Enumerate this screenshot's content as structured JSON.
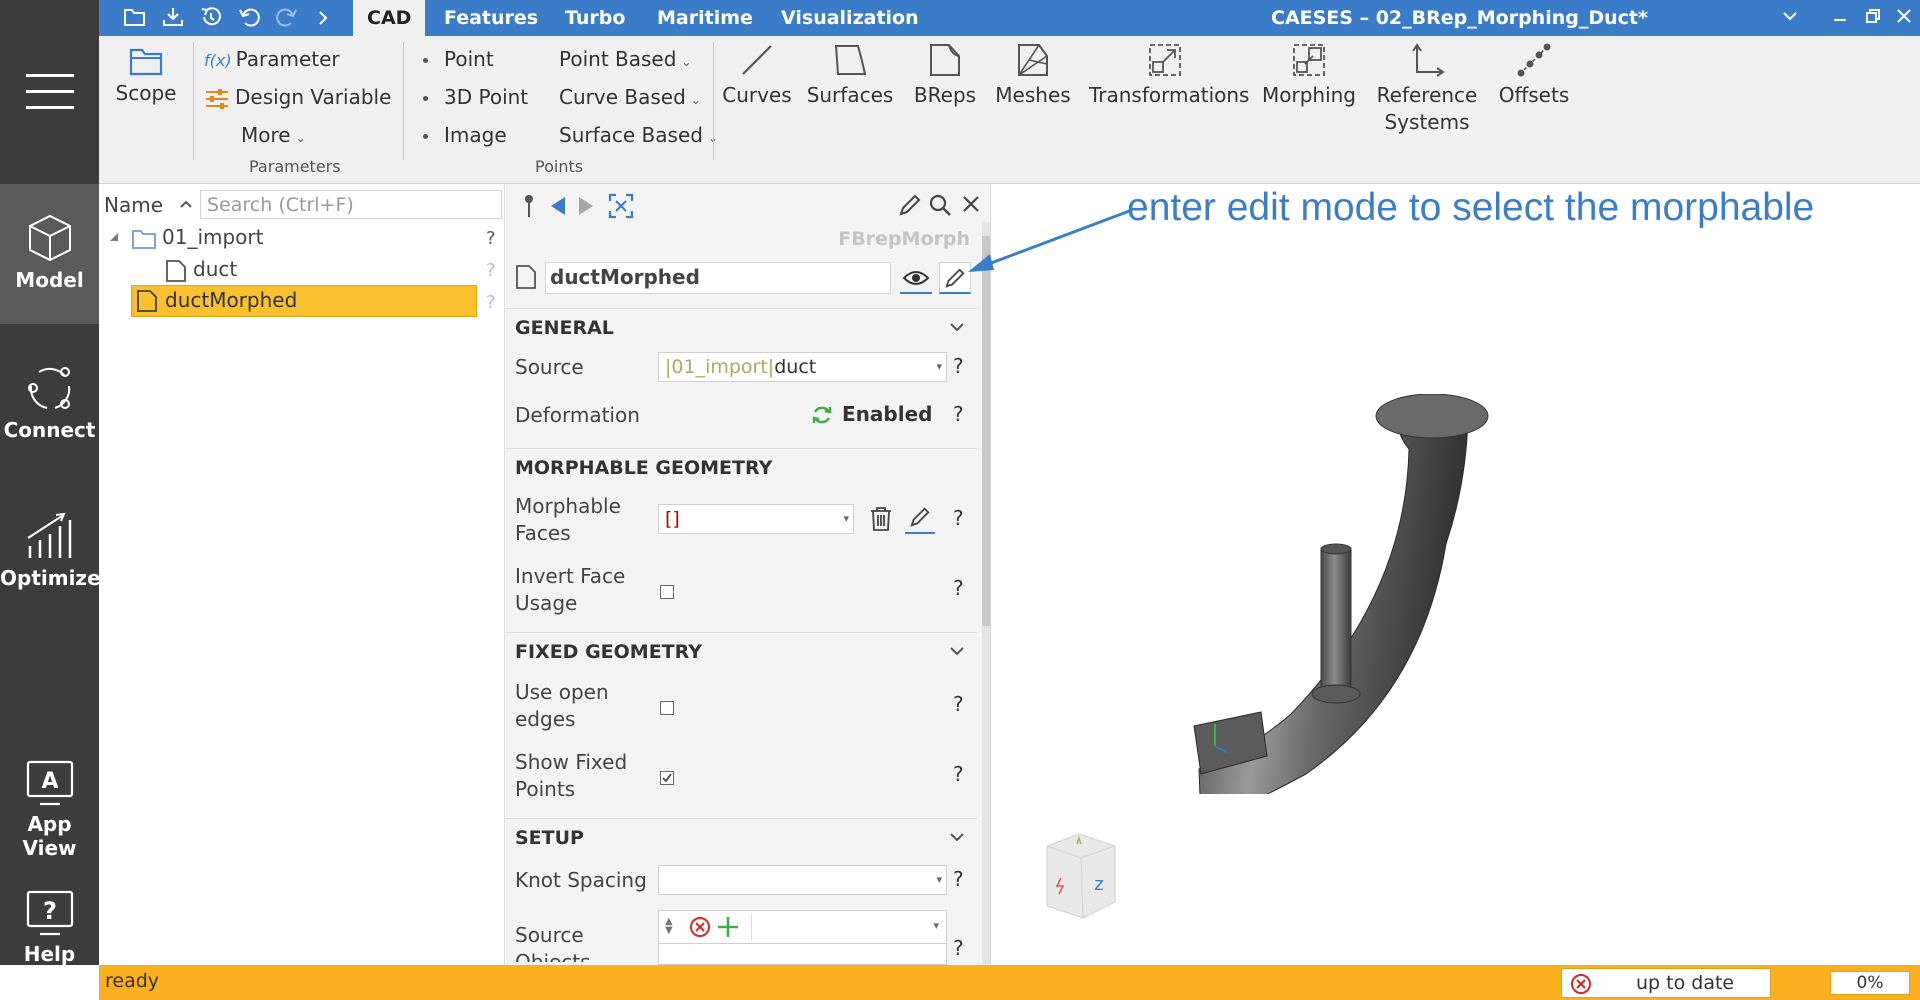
{
  "window": {
    "title": "CAESES – 02_BRep_Morphing_Duct*",
    "menu_tabs": [
      "CAD",
      "Features",
      "Turbo",
      "Maritime",
      "Visualization"
    ],
    "active_tab": "CAD"
  },
  "leftnav": {
    "items": [
      {
        "label": "Model",
        "icon": "cube-icon",
        "active": true
      },
      {
        "label": "Connect",
        "icon": "connect-icon",
        "active": false
      },
      {
        "label": "Optimize",
        "icon": "chart-icon",
        "active": false
      },
      {
        "label": "App View",
        "icon": "app-view-icon",
        "active": false
      },
      {
        "label": "Help",
        "icon": "help-icon",
        "active": false
      }
    ]
  },
  "ribbon": {
    "scope_label": "Scope",
    "parameter_label": "Parameter",
    "parameter_prefix": "f(x)",
    "design_variable_label": "Design Variable",
    "more_label": "More",
    "parameters_group": "Parameters",
    "point_label": "Point",
    "point3d_label": "3D Point",
    "image_label": "Image",
    "point_based_label": "Point Based",
    "curve_based_label": "Curve Based",
    "surface_based_label": "Surface Based",
    "points_group": "Points",
    "curves_label": "Curves",
    "surfaces_label": "Surfaces",
    "breps_label": "BReps",
    "meshes_label": "Meshes",
    "transformations_label": "Transformations",
    "morphing_label": "Morphing",
    "reference_label_1": "Reference",
    "reference_label_2": "Systems",
    "offsets_label": "Offsets"
  },
  "tree": {
    "name_header": "Name",
    "search_placeholder": "Search (Ctrl+F)",
    "items": [
      {
        "label": "01_import",
        "type": "folder"
      },
      {
        "label": "duct",
        "type": "object"
      },
      {
        "label": "ductMorphed",
        "type": "object",
        "selected": true
      }
    ],
    "help_mark": "?"
  },
  "properties": {
    "type_label": "FBrepMorph",
    "object_name": "ductMorphed",
    "help_mark": "?",
    "sections": {
      "general": "GENERAL",
      "morphable": "MORPHABLE GEOMETRY",
      "fixed": "FIXED GEOMETRY",
      "setup": "SETUP"
    },
    "source_label": "Source",
    "source_prefix": "|01_import|",
    "source_value": "duct",
    "deformation_label": "Deformation",
    "deformation_value": "Enabled",
    "morphable_faces_label_1": "Morphable",
    "morphable_faces_label_2": "Faces",
    "morphable_faces_value": "[]",
    "invert_label_1": "Invert Face",
    "invert_label_2": "Usage",
    "invert_checked": false,
    "open_edges_label_1": "Use open",
    "open_edges_label_2": "edges",
    "open_edges_checked": false,
    "show_fixed_label_1": "Show Fixed",
    "show_fixed_label_2": "Points",
    "show_fixed_checked": true,
    "knot_spacing_label": "Knot Spacing",
    "knot_spacing_value": "",
    "source_objects_label_1": "Source",
    "source_objects_label_2": "Objects"
  },
  "viewport": {
    "annotation": "enter edit mode to select the morphable",
    "annotation_color": "#3a7ec7",
    "cube_label": "z"
  },
  "status": {
    "text": "ready",
    "update_text": "up to date",
    "progress": "0%"
  },
  "colors": {
    "accent": "#3a7cc8",
    "status_bar": "#fbb11f",
    "selection": "#fbc02d",
    "leftnav": "#3c3c3c"
  }
}
